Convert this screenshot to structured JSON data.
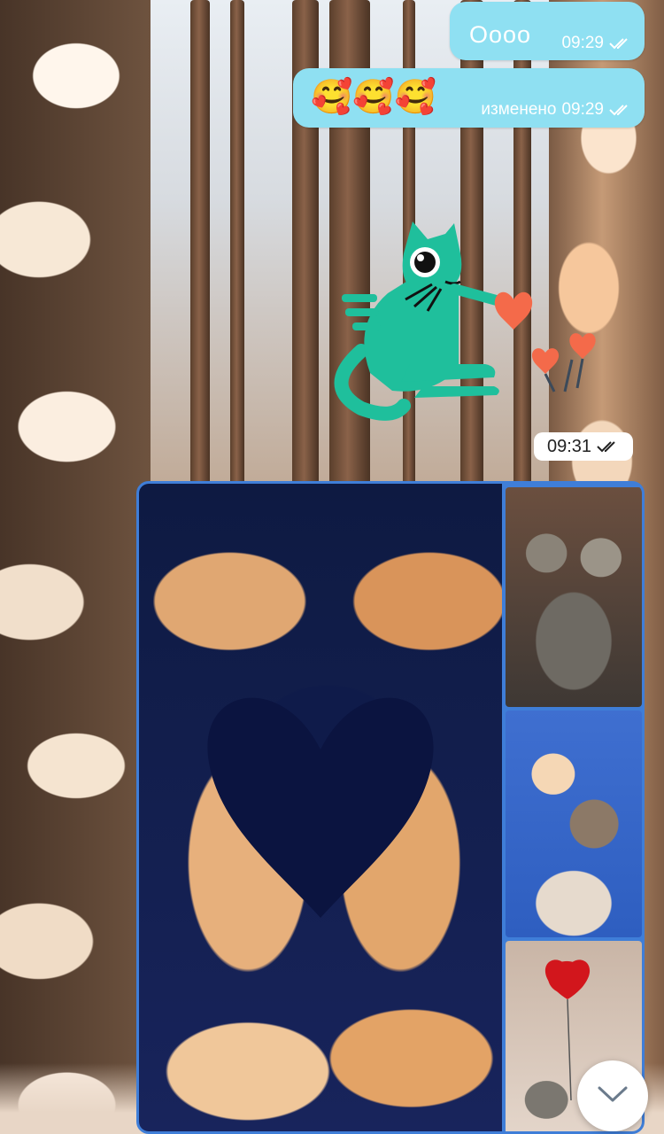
{
  "messages": [
    {
      "text": "Оооо",
      "time": "09:29",
      "status": "read"
    },
    {
      "text": "🥰🥰🥰",
      "edited_label": "изменено",
      "time": "09:29",
      "status": "read"
    }
  ],
  "sticker": {
    "icon": "green-cat-with-hearts-sticker",
    "time": "09:31",
    "status": "read"
  },
  "album": {
    "photos": [
      {
        "icon": "kittens-heart-photo"
      },
      {
        "icon": "hugging-kittens-photo"
      },
      {
        "icon": "kissing-kittens-photo"
      },
      {
        "icon": "heart-balloon-hedgehogs-photo"
      }
    ]
  },
  "scroll_button": {
    "icon": "chevron-down-icon"
  },
  "colors": {
    "bubble": "#8fe0f2",
    "album_border": "#3f7ed8",
    "sticker_cat": "#1fbf9c",
    "sticker_heart": "#f46a4a"
  }
}
